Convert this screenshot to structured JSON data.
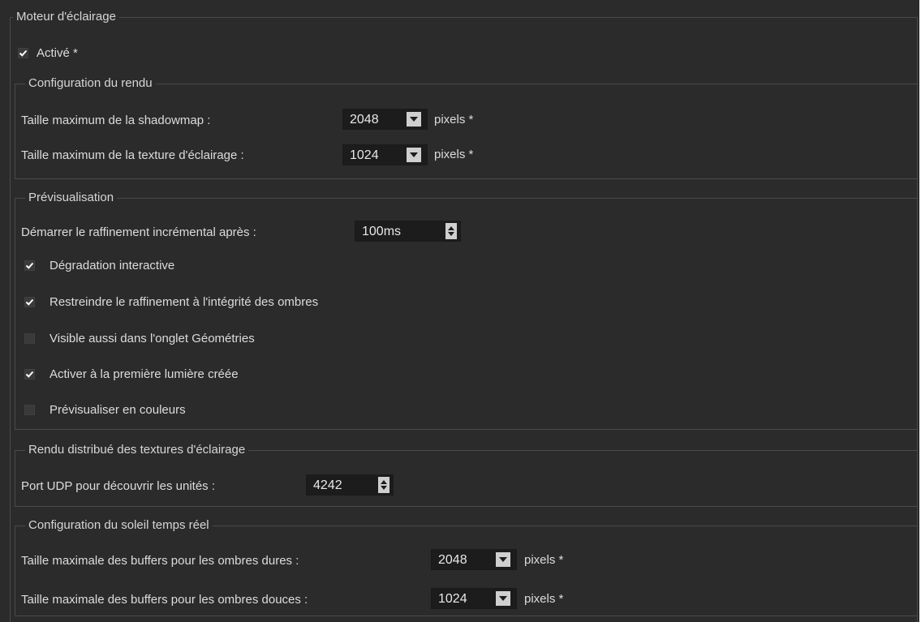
{
  "lighting_engine": {
    "title": "Moteur d'éclairage",
    "enabled": {
      "label": "Activé *",
      "checked": true
    }
  },
  "render_config": {
    "title": "Configuration du rendu",
    "shadowmap": {
      "label": "Taille maximum de la shadowmap :",
      "value": "2048",
      "suffix": "pixels *"
    },
    "lighting_texture": {
      "label": "Taille maximum de la texture d'éclairage :",
      "value": "1024",
      "suffix": "pixels *"
    }
  },
  "preview": {
    "title": "Prévisualisation",
    "refinement_delay": {
      "label": "Démarrer le raffinement incrémental après :",
      "value": "100ms"
    },
    "checkboxes": [
      {
        "label": "Dégradation interactive",
        "checked": true
      },
      {
        "label": "Restreindre le raffinement à l'intégrité des ombres",
        "checked": true
      },
      {
        "label": "Visible aussi dans l'onglet Géométries",
        "checked": false
      },
      {
        "label": "Activer à la première lumière créée",
        "checked": true
      },
      {
        "label": "Prévisualiser en couleurs",
        "checked": false
      }
    ]
  },
  "distributed": {
    "title": "Rendu distribué des textures d'éclairage",
    "udp_port": {
      "label": "Port UDP pour découvrir les unités :",
      "value": "4242"
    }
  },
  "sun_config": {
    "title": "Configuration du soleil temps réel",
    "hard_shadows": {
      "label": "Taille maximale des buffers pour les ombres dures :",
      "value": "2048",
      "suffix": "pixels *"
    },
    "soft_shadows": {
      "label": "Taille maximale des buffers pour les ombres douces :",
      "value": "1024",
      "suffix": "pixels *"
    }
  },
  "colors": {
    "panel_bg": "#2b2b2b",
    "field_bg": "#1c1c1c",
    "border": "#4a4a4a",
    "text": "#dcdcdc",
    "button_face": "#cfcfcf"
  }
}
